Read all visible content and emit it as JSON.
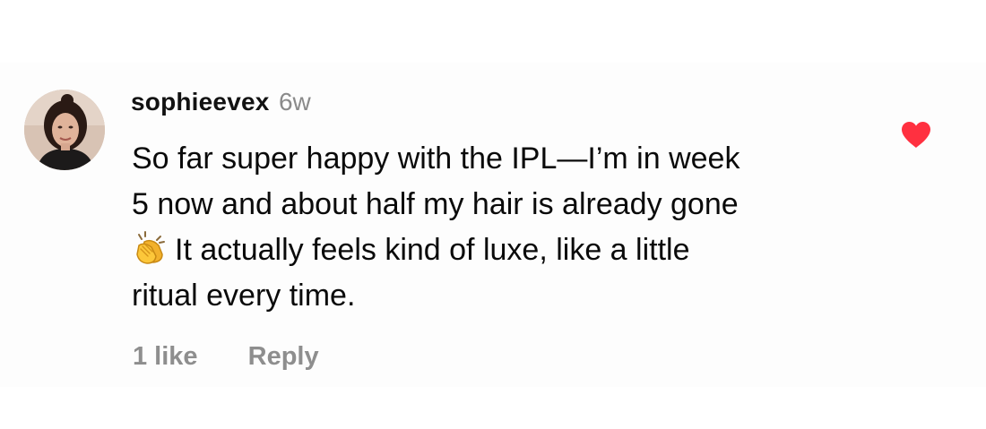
{
  "comment": {
    "username": "sophieevex",
    "age": "6w",
    "text_lines": [
      "So far super happy with the IPL—I’m in week",
      "5 now and about half my hair is already gone",
      "It actually feels kind of luxe, like a little",
      "ritual every time."
    ],
    "emoji_icon": "clapping-hands-icon",
    "likes_label": "1 like",
    "reply_label": "Reply",
    "liked": true
  },
  "colors": {
    "heart": "#ff3040",
    "muted_text": "#8e8e8e",
    "username": "#121212"
  },
  "icons": {
    "avatar": "profile-photo-avatar",
    "like": "heart-icon"
  }
}
